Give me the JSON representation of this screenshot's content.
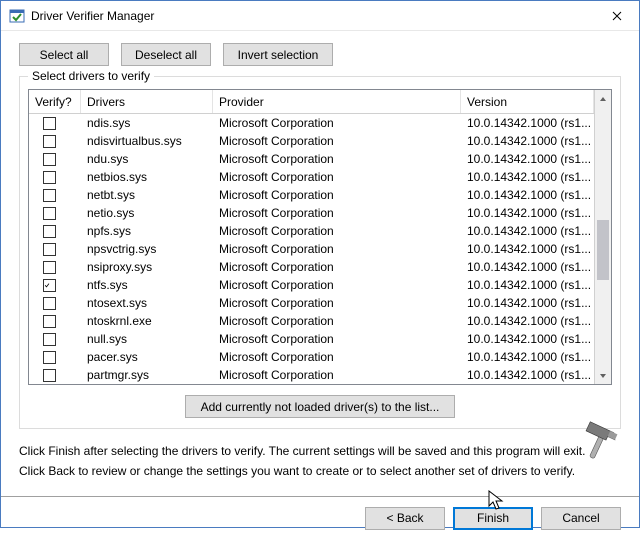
{
  "window": {
    "title": "Driver Verifier Manager"
  },
  "toolbar": {
    "select_all": "Select all",
    "deselect_all": "Deselect all",
    "invert": "Invert selection"
  },
  "group": {
    "legend": "Select drivers to verify",
    "columns": {
      "verify": "Verify?",
      "drivers": "Drivers",
      "provider": "Provider",
      "version": "Version"
    },
    "rows": [
      {
        "checked": false,
        "driver": "ndis.sys",
        "provider": "Microsoft Corporation",
        "version": "10.0.14342.1000 (rs1..."
      },
      {
        "checked": false,
        "driver": "ndisvirtualbus.sys",
        "provider": "Microsoft Corporation",
        "version": "10.0.14342.1000 (rs1..."
      },
      {
        "checked": false,
        "driver": "ndu.sys",
        "provider": "Microsoft Corporation",
        "version": "10.0.14342.1000 (rs1..."
      },
      {
        "checked": false,
        "driver": "netbios.sys",
        "provider": "Microsoft Corporation",
        "version": "10.0.14342.1000 (rs1..."
      },
      {
        "checked": false,
        "driver": "netbt.sys",
        "provider": "Microsoft Corporation",
        "version": "10.0.14342.1000 (rs1..."
      },
      {
        "checked": false,
        "driver": "netio.sys",
        "provider": "Microsoft Corporation",
        "version": "10.0.14342.1000 (rs1..."
      },
      {
        "checked": false,
        "driver": "npfs.sys",
        "provider": "Microsoft Corporation",
        "version": "10.0.14342.1000 (rs1..."
      },
      {
        "checked": false,
        "driver": "npsvctrig.sys",
        "provider": "Microsoft Corporation",
        "version": "10.0.14342.1000 (rs1..."
      },
      {
        "checked": false,
        "driver": "nsiproxy.sys",
        "provider": "Microsoft Corporation",
        "version": "10.0.14342.1000 (rs1..."
      },
      {
        "checked": true,
        "driver": "ntfs.sys",
        "provider": "Microsoft Corporation",
        "version": "10.0.14342.1000 (rs1..."
      },
      {
        "checked": false,
        "driver": "ntosext.sys",
        "provider": "Microsoft Corporation",
        "version": "10.0.14342.1000 (rs1..."
      },
      {
        "checked": false,
        "driver": "ntoskrnl.exe",
        "provider": "Microsoft Corporation",
        "version": "10.0.14342.1000 (rs1..."
      },
      {
        "checked": false,
        "driver": "null.sys",
        "provider": "Microsoft Corporation",
        "version": "10.0.14342.1000 (rs1..."
      },
      {
        "checked": false,
        "driver": "pacer.sys",
        "provider": "Microsoft Corporation",
        "version": "10.0.14342.1000 (rs1..."
      },
      {
        "checked": false,
        "driver": "partmgr.sys",
        "provider": "Microsoft Corporation",
        "version": "10.0.14342.1000 (rs1..."
      }
    ],
    "add_not_loaded": "Add currently not loaded driver(s) to the list..."
  },
  "instructions": {
    "line1": "Click Finish after selecting the drivers to verify. The current settings will be saved and this program will exit.",
    "line2": "Click Back to review or change the settings you want to create or to select another set of drivers to verify."
  },
  "footer": {
    "back": "< Back",
    "finish": "Finish",
    "cancel": "Cancel"
  }
}
